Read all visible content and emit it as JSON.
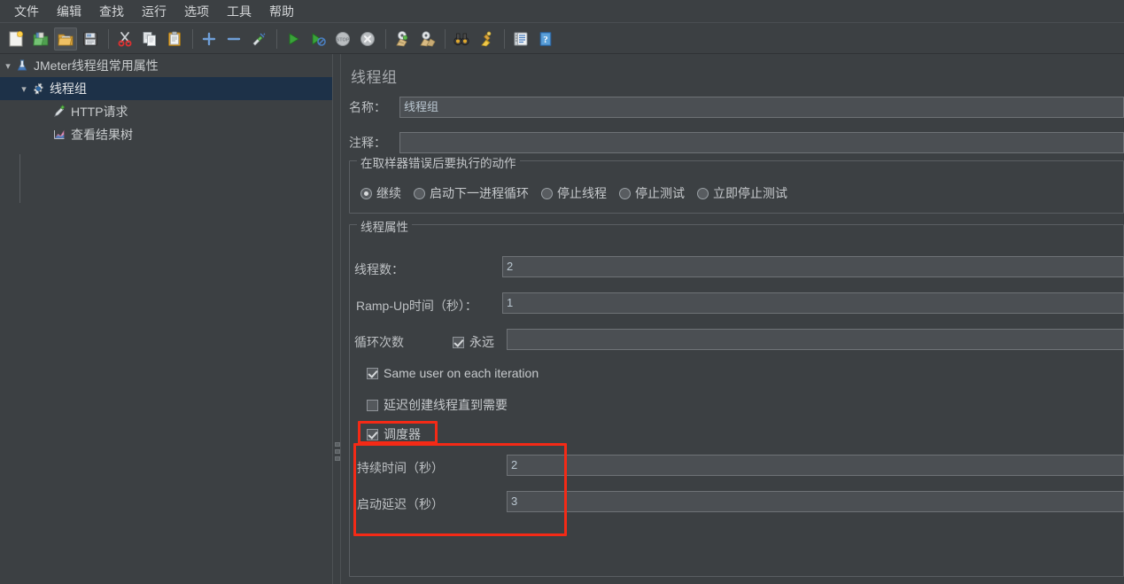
{
  "menu": {
    "items": [
      {
        "label": "文件",
        "name": "menu-file"
      },
      {
        "label": "编辑",
        "name": "menu-edit"
      },
      {
        "label": "查找",
        "name": "menu-search"
      },
      {
        "label": "运行",
        "name": "menu-run"
      },
      {
        "label": "选项",
        "name": "menu-options"
      },
      {
        "label": "工具",
        "name": "menu-tools"
      },
      {
        "label": "帮助",
        "name": "menu-help"
      }
    ]
  },
  "toolbar": {
    "buttons": [
      {
        "icon": "new-document-icon",
        "title": "新建"
      },
      {
        "icon": "open-templates-icon",
        "title": "模板"
      },
      {
        "icon": "open-folder-icon",
        "title": "打开"
      },
      {
        "icon": "save-floppy-icon",
        "title": "保存"
      },
      {
        "icon": "cut-scissors-icon",
        "title": "剪切"
      },
      {
        "icon": "copy-icon",
        "title": "复制"
      },
      {
        "icon": "paste-clipboard-icon",
        "title": "粘贴"
      },
      {
        "icon": "plus-expand-icon",
        "title": "展开"
      },
      {
        "icon": "minus-collapse-icon",
        "title": "折叠"
      },
      {
        "icon": "toggle-enable-icon",
        "title": "切换"
      },
      {
        "icon": "start-play-icon",
        "title": "启动"
      },
      {
        "icon": "start-no-pause-icon",
        "title": "无暂停启动"
      },
      {
        "icon": "stop-icon",
        "title": "停止"
      },
      {
        "icon": "shutdown-icon",
        "title": "关闭"
      },
      {
        "icon": "clear-broom-icon",
        "title": "清除"
      },
      {
        "icon": "clear-all-broom-icon",
        "title": "清除全部"
      },
      {
        "icon": "search-binoculars-icon",
        "title": "搜索"
      },
      {
        "icon": "reset-search-icon",
        "title": "重置搜索"
      },
      {
        "icon": "function-helper-icon",
        "title": "函数助手对话框"
      },
      {
        "icon": "help-question-icon",
        "title": "帮助"
      }
    ]
  },
  "tree": {
    "nodes": [
      {
        "label": "JMeter线程组常用属性",
        "icon": "test-plan-icon",
        "depth": 0,
        "expanded": true,
        "selected": false
      },
      {
        "label": "线程组",
        "icon": "thread-group-gear-icon",
        "depth": 1,
        "expanded": true,
        "selected": true
      },
      {
        "label": "HTTP请求",
        "icon": "http-sampler-pen-icon",
        "depth": 2,
        "expanded": null,
        "selected": false
      },
      {
        "label": "查看结果树",
        "icon": "view-results-tree-icon",
        "depth": 2,
        "expanded": null,
        "selected": false
      }
    ]
  },
  "editor": {
    "title": "线程组",
    "name_label": "名称：",
    "name_value": "线程组",
    "comment_label": "注释：",
    "comment_value": "",
    "error_action": {
      "group_title": "在取样器错误后要执行的动作",
      "options": [
        {
          "label": "继续",
          "selected": true
        },
        {
          "label": "启动下一进程循环",
          "selected": false
        },
        {
          "label": "停止线程",
          "selected": false
        },
        {
          "label": "停止测试",
          "selected": false
        },
        {
          "label": "立即停止测试",
          "selected": false
        }
      ]
    },
    "thread_properties": {
      "group_title": "线程属性",
      "threads_label": "线程数：",
      "threads_value": "2",
      "rampup_label": "Ramp-Up时间（秒）：",
      "rampup_value": "1",
      "loops_label": "循环次数",
      "forever_label": "永远",
      "forever_checked": true,
      "loops_value": "",
      "same_user_label": "Same user on each iteration",
      "same_user_checked": true,
      "delayed_start_label": "延迟创建线程直到需要",
      "delayed_start_checked": false,
      "scheduler_label": "调度器",
      "scheduler_checked": true,
      "duration_label": "持续时间（秒）",
      "duration_value": "2",
      "startup_delay_label": "启动延迟（秒）",
      "startup_delay_value": "3"
    }
  },
  "colors": {
    "background": "#3c4043",
    "panel": "#3c4043",
    "input_bg": "#4b4f53",
    "input_border": "#6e7276",
    "text": "#c6c9cc",
    "selected_row": "#1d3148",
    "highlight": "#f42a16",
    "value_text": "#b9c6d0"
  }
}
